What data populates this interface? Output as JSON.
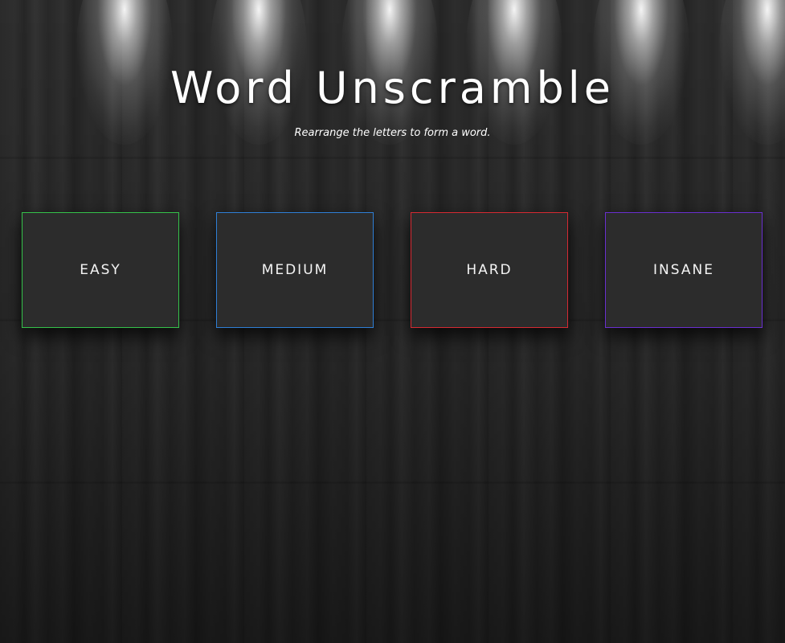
{
  "title": "Word Unscramble",
  "subtitle": "Rearrange the letters to form a word.",
  "difficulties": [
    {
      "label": "EASY",
      "color": "#35c24a"
    },
    {
      "label": "MEDIUM",
      "color": "#2f7fd6"
    },
    {
      "label": "HARD",
      "color": "#d62a32"
    },
    {
      "label": "INSANE",
      "color": "#6a2fd0"
    }
  ]
}
